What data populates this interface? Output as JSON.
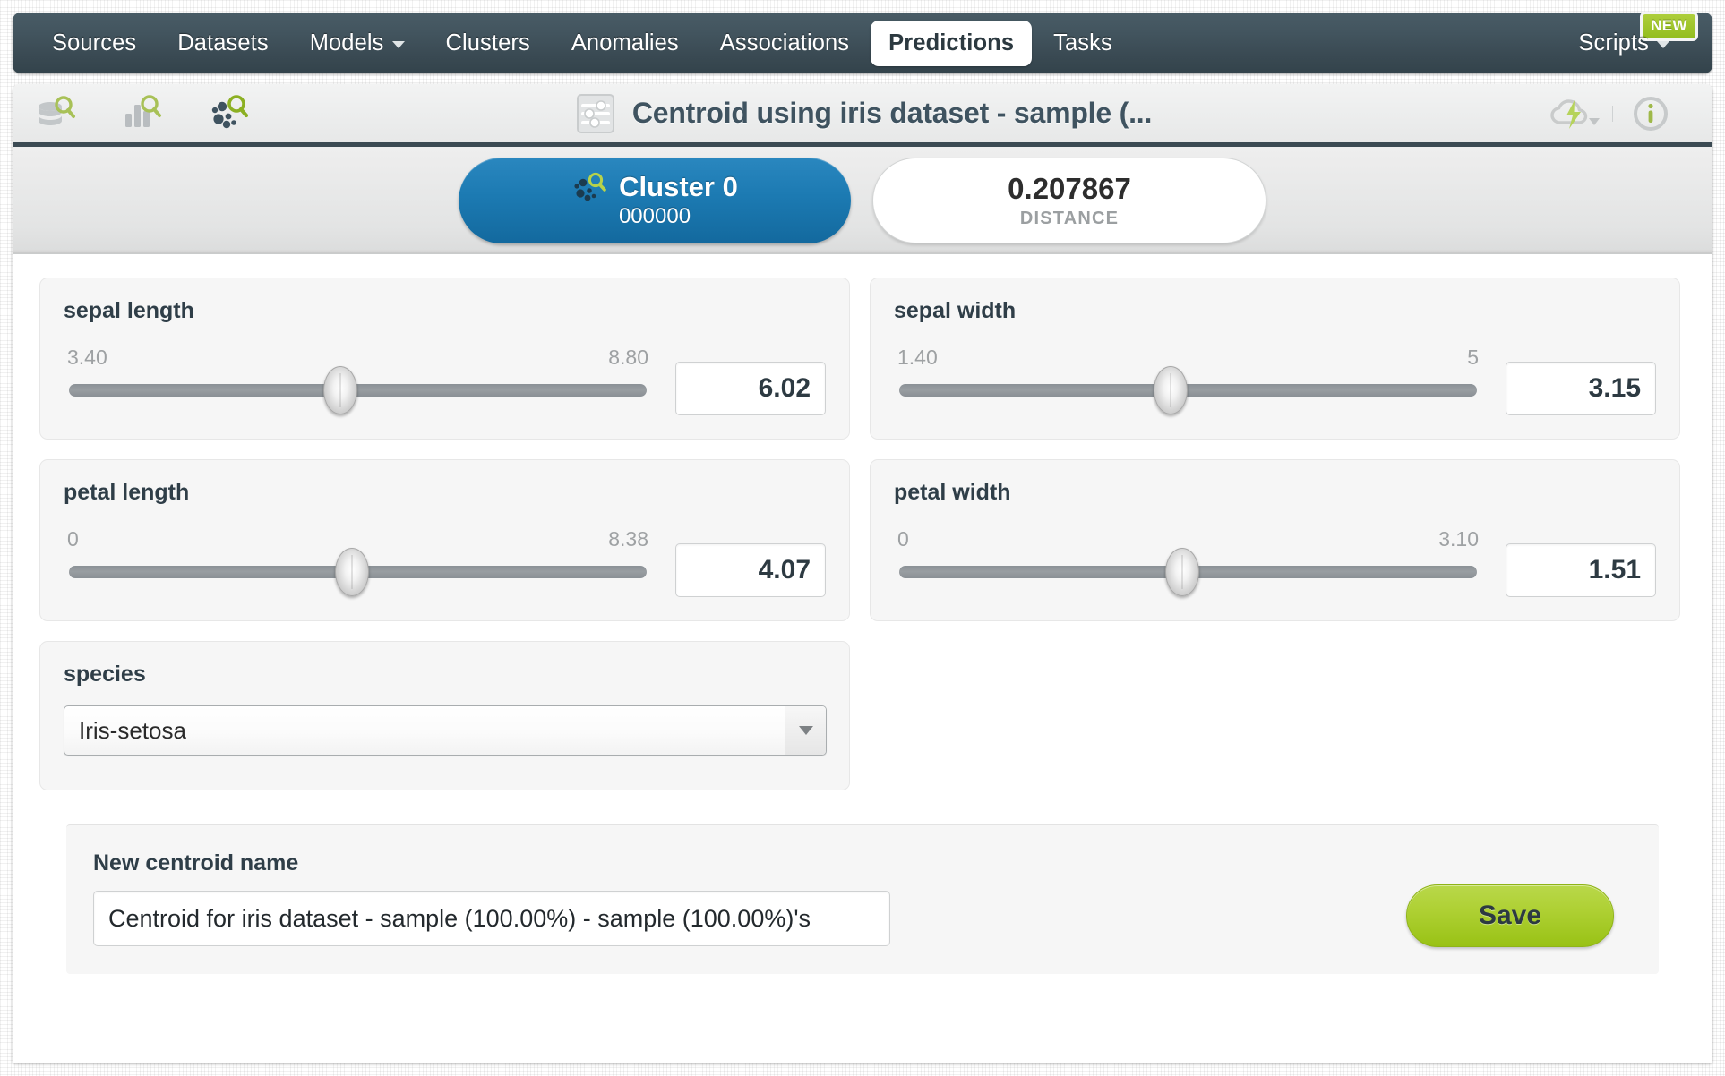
{
  "nav": {
    "items": [
      {
        "label": "Sources",
        "active": false,
        "dropdown": false
      },
      {
        "label": "Datasets",
        "active": false,
        "dropdown": false
      },
      {
        "label": "Models",
        "active": false,
        "dropdown": true
      },
      {
        "label": "Clusters",
        "active": false,
        "dropdown": false
      },
      {
        "label": "Anomalies",
        "active": false,
        "dropdown": false
      },
      {
        "label": "Associations",
        "active": false,
        "dropdown": false
      },
      {
        "label": "Predictions",
        "active": true,
        "dropdown": false
      },
      {
        "label": "Tasks",
        "active": false,
        "dropdown": false
      }
    ],
    "scripts_label": "Scripts",
    "new_badge": "NEW"
  },
  "toolbar": {
    "title": "Centroid using iris dataset - sample (...",
    "icons": [
      "dataset-search-icon",
      "model-search-icon",
      "cluster-search-icon"
    ],
    "right_icons": [
      "cloud-action-icon",
      "info-icon"
    ]
  },
  "cluster": {
    "name": "Cluster 0",
    "id": "000000",
    "distance_value": "0.207867",
    "distance_label": "DISTANCE"
  },
  "fields": [
    {
      "name": "sepal length",
      "min_label": "3.40",
      "max_label": "8.80",
      "value": "6.02",
      "thumb_pct": 47
    },
    {
      "name": "sepal width",
      "min_label": "1.40",
      "max_label": "5",
      "value": "3.15",
      "thumb_pct": 47
    },
    {
      "name": "petal length",
      "min_label": "0",
      "max_label": "8.38",
      "value": "4.07",
      "thumb_pct": 49
    },
    {
      "name": "petal width",
      "min_label": "0",
      "max_label": "3.10",
      "value": "1.51",
      "thumb_pct": 49
    }
  ],
  "species": {
    "label": "species",
    "selected": "Iris-setosa"
  },
  "save": {
    "label": "New centroid name",
    "name_value": "Centroid for iris dataset - sample (100.00%) - sample (100.00%)'s",
    "button_label": "Save"
  },
  "colors": {
    "nav_bg": "#3d4e58",
    "accent_blue": "#1c7ab2",
    "accent_green": "#a4cb27",
    "title_text": "#3f5360"
  }
}
